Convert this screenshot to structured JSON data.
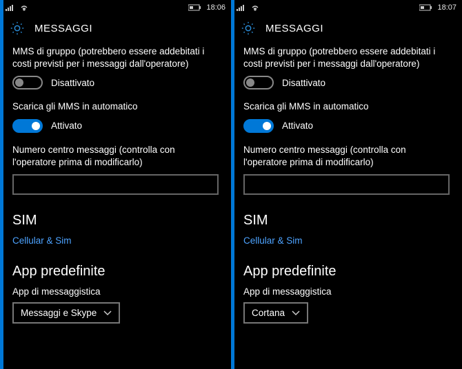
{
  "screens": [
    {
      "statusbar": {
        "time": "18:06"
      },
      "header": {
        "title": "MESSAGGI"
      },
      "groupMms": {
        "label": "MMS di gruppo (potrebbero essere addebitati i costi previsti per i messaggi dall'operatore)",
        "state_text": "Disattivato",
        "on": false
      },
      "autoDownload": {
        "label": "Scarica gli MMS in automatico",
        "state_text": "Attivato",
        "on": true
      },
      "smsc": {
        "label": "Numero centro messaggi (controlla con l'operatore prima di modificarlo)",
        "value": ""
      },
      "sim": {
        "heading": "SIM",
        "link": "Cellular & Sim"
      },
      "defaultApps": {
        "heading": "App predefinite",
        "label": "App di messaggistica",
        "selected": "Messaggi e Skype"
      }
    },
    {
      "statusbar": {
        "time": "18:07"
      },
      "header": {
        "title": "MESSAGGI"
      },
      "groupMms": {
        "label": "MMS di gruppo (potrebbero essere addebitati i costi previsti per i messaggi dall'operatore)",
        "state_text": "Disattivato",
        "on": false
      },
      "autoDownload": {
        "label": "Scarica gli MMS in automatico",
        "state_text": "Attivato",
        "on": true
      },
      "smsc": {
        "label": "Numero centro messaggi (controlla con l'operatore prima di modificarlo)",
        "value": ""
      },
      "sim": {
        "heading": "SIM",
        "link": "Cellular & Sim"
      },
      "defaultApps": {
        "heading": "App predefinite",
        "label": "App di messaggistica",
        "selected": "Cortana"
      }
    }
  ],
  "colors": {
    "accent": "#0078d7",
    "link": "#4da3ff"
  }
}
